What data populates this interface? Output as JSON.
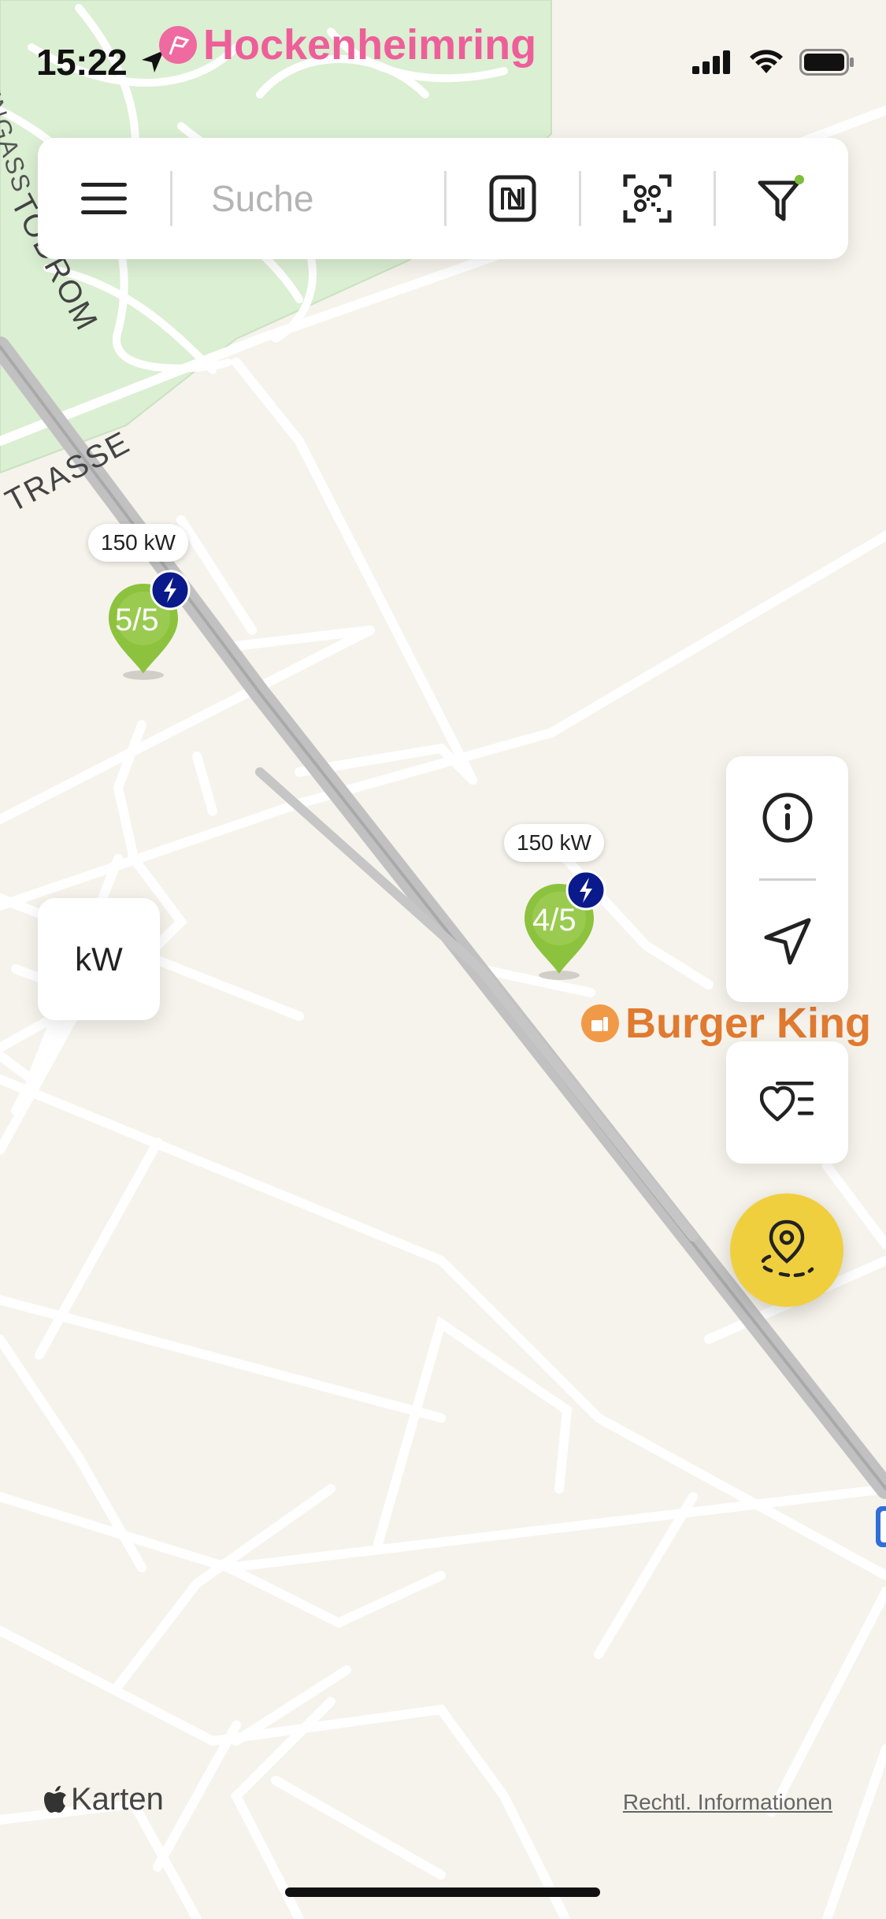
{
  "status_bar": {
    "time": "15:22"
  },
  "map_labels": {
    "poi_top": "Hockenheimring",
    "poi_restaurant": "Burger King",
    "road_1": "ENGASS",
    "road_2": "TODROM",
    "road_3": "TRASSE"
  },
  "search": {
    "placeholder": "Suche"
  },
  "toolbar": {
    "icons": [
      "menu-icon",
      "nfc-icon",
      "qr-scan-icon",
      "filter-icon"
    ]
  },
  "markers": [
    {
      "power": "150 kW",
      "availability": "5/5",
      "color": "#8dc23f"
    },
    {
      "power": "150 kW",
      "availability": "4/5",
      "color": "#8dc23f"
    }
  ],
  "buttons": {
    "kw": "kW",
    "side_icons": [
      "info-icon",
      "locate-icon",
      "favorites-icon",
      "route-planner-icon"
    ]
  },
  "footer": {
    "attribution": "Karten",
    "legal": "Rechtl. Informationen"
  },
  "colors": {
    "map_bg": "#f6f3ec",
    "park_green": "#dbefd3",
    "marker_green": "#8dc23f",
    "fast_badge": "#0b1a8a",
    "accent_yellow": "#f0cf3f"
  }
}
